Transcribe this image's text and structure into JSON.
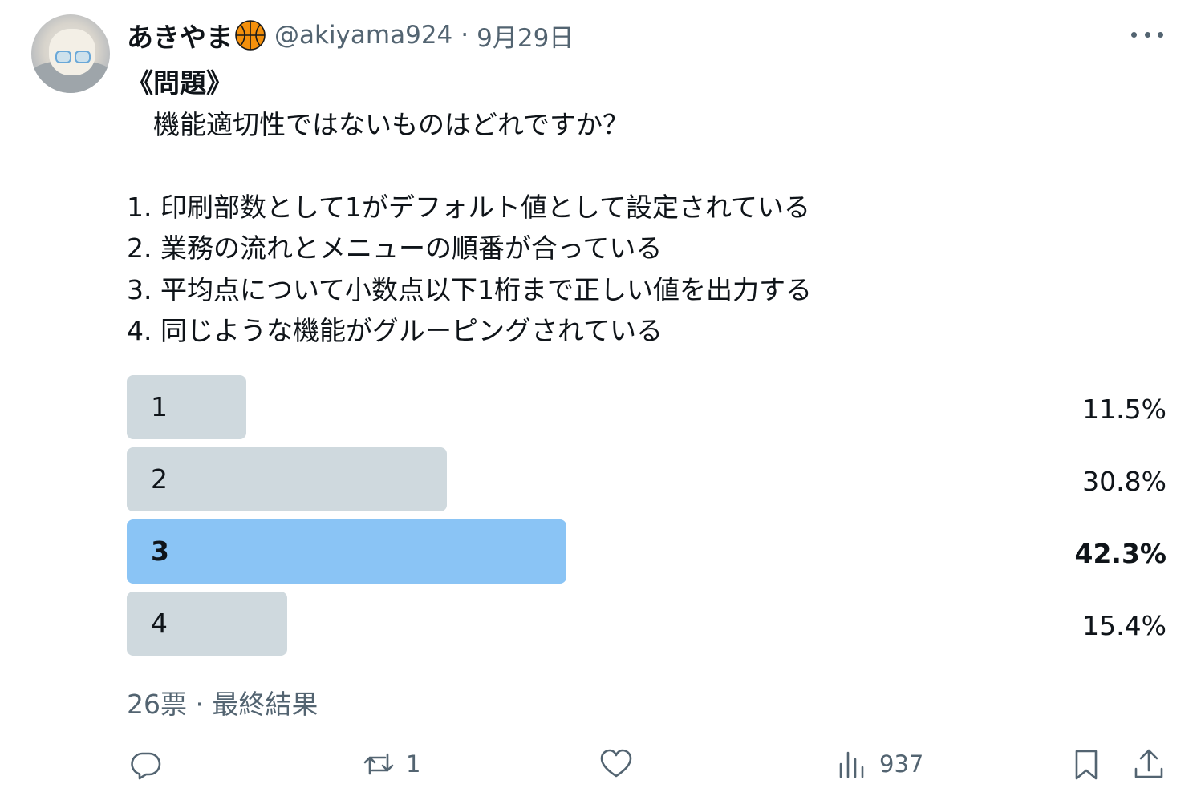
{
  "author": {
    "name": "あきやま",
    "badge_icon": "basketball-icon",
    "handle": "@akiyama924",
    "separator": "·",
    "date": "9月29日"
  },
  "menu": {
    "icon": "more-icon"
  },
  "post": {
    "heading": "《問題》",
    "question": "　機能適切性ではないものはどれですか？",
    "options": [
      "1. 印刷部数として1がデフォルト値として設定されている",
      "2. 業務の流れとメニューの順番が合っている",
      "3. 平均点について小数点以下1桁まで正しい値を出力する",
      "4. 同じような機能がグルーピングされている"
    ]
  },
  "poll": {
    "choices": [
      {
        "label": "1",
        "percent_text": "11.5%",
        "percent": 11.5,
        "winner": false
      },
      {
        "label": "2",
        "percent_text": "30.8%",
        "percent": 30.8,
        "winner": false
      },
      {
        "label": "3",
        "percent_text": "42.3%",
        "percent": 42.3,
        "winner": true
      },
      {
        "label": "4",
        "percent_text": "15.4%",
        "percent": 15.4,
        "winner": false
      }
    ],
    "footer": "26票 · 最終結果",
    "bar_color": "#cfd9de",
    "winner_color": "#8ac4f5"
  },
  "actions": {
    "reply": {
      "icon": "reply-icon",
      "count": ""
    },
    "retweet": {
      "icon": "retweet-icon",
      "count": "1"
    },
    "like": {
      "icon": "heart-icon",
      "count": ""
    },
    "views": {
      "icon": "views-icon",
      "count": "937"
    },
    "bookmark": {
      "icon": "bookmark-icon"
    },
    "share": {
      "icon": "share-icon"
    }
  }
}
